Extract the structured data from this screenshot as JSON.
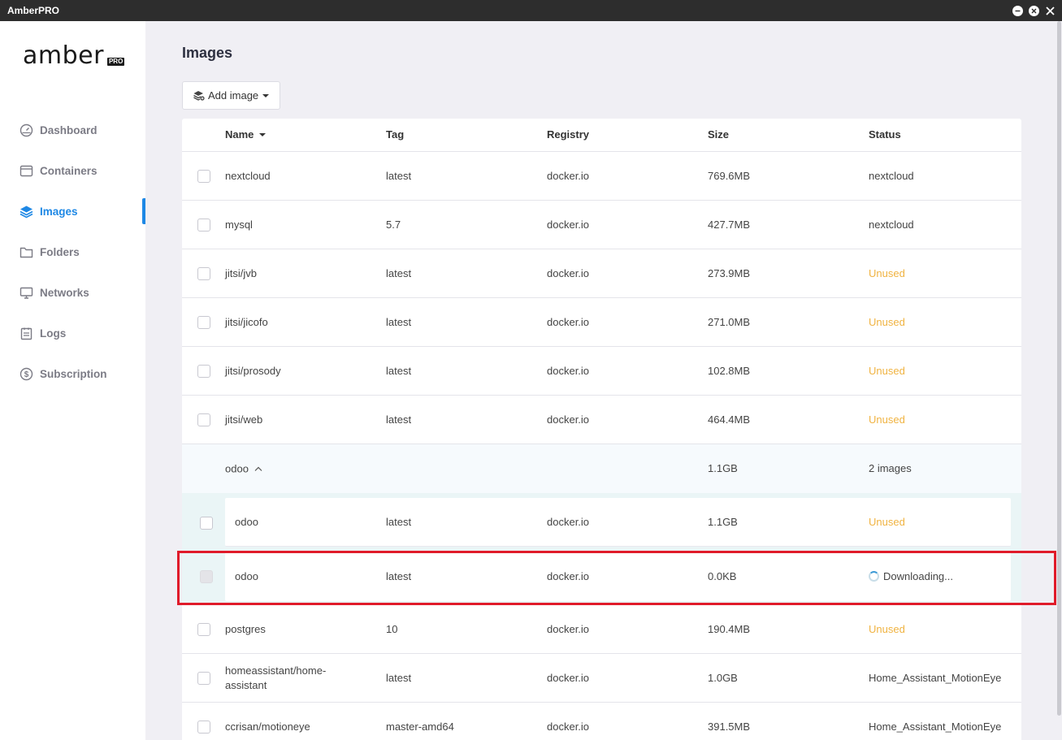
{
  "window": {
    "title": "AmberPRO"
  },
  "logo": {
    "text": "amber",
    "badge": "PRO"
  },
  "nav": [
    {
      "label": "Dashboard",
      "icon": "dashboard-icon",
      "active": false
    },
    {
      "label": "Containers",
      "icon": "container-icon",
      "active": false
    },
    {
      "label": "Images",
      "icon": "layers-icon",
      "active": true
    },
    {
      "label": "Folders",
      "icon": "folder-icon",
      "active": false
    },
    {
      "label": "Networks",
      "icon": "monitor-icon",
      "active": false
    },
    {
      "label": "Logs",
      "icon": "clipboard-icon",
      "active": false
    },
    {
      "label": "Subscription",
      "icon": "dollar-icon",
      "active": false
    }
  ],
  "page": {
    "title": "Images",
    "add_button": "Add image"
  },
  "table": {
    "columns": [
      "Name",
      "Tag",
      "Registry",
      "Size",
      "Status"
    ],
    "rows": [
      {
        "name": "nextcloud",
        "tag": "latest",
        "registry": "docker.io",
        "size": "769.6MB",
        "status": "nextcloud",
        "unused": false
      },
      {
        "name": "mysql",
        "tag": "5.7",
        "registry": "docker.io",
        "size": "427.7MB",
        "status": "nextcloud",
        "unused": false
      },
      {
        "name": "jitsi/jvb",
        "tag": "latest",
        "registry": "docker.io",
        "size": "273.9MB",
        "status": "Unused",
        "unused": true
      },
      {
        "name": "jitsi/jicofo",
        "tag": "latest",
        "registry": "docker.io",
        "size": "271.0MB",
        "status": "Unused",
        "unused": true
      },
      {
        "name": "jitsi/prosody",
        "tag": "latest",
        "registry": "docker.io",
        "size": "102.8MB",
        "status": "Unused",
        "unused": true
      },
      {
        "name": "jitsi/web",
        "tag": "latest",
        "registry": "docker.io",
        "size": "464.4MB",
        "status": "Unused",
        "unused": true
      }
    ],
    "group": {
      "name": "odoo",
      "size": "1.1GB",
      "status": "2 images",
      "items": [
        {
          "name": "odoo",
          "tag": "latest",
          "registry": "docker.io",
          "size": "1.1GB",
          "status": "Unused"
        },
        {
          "name": "odoo",
          "tag": "latest",
          "registry": "docker.io",
          "size": "0.0KB",
          "status": "Downloading..."
        }
      ]
    },
    "rows_after": [
      {
        "name": "postgres",
        "tag": "10",
        "registry": "docker.io",
        "size": "190.4MB",
        "status": "Unused",
        "unused": true
      },
      {
        "name": "homeassistant/home-assistant",
        "tag": "latest",
        "registry": "docker.io",
        "size": "1.0GB",
        "status": "Home_Assistant_MotionEye",
        "unused": false
      },
      {
        "name": "ccrisan/motioneye",
        "tag": "master-amd64",
        "registry": "docker.io",
        "size": "391.5MB",
        "status": "Home_Assistant_MotionEye",
        "unused": false
      }
    ]
  },
  "colors": {
    "accent": "#1e88e5",
    "unused": "#f0b341",
    "highlight": "#e01b2a"
  }
}
